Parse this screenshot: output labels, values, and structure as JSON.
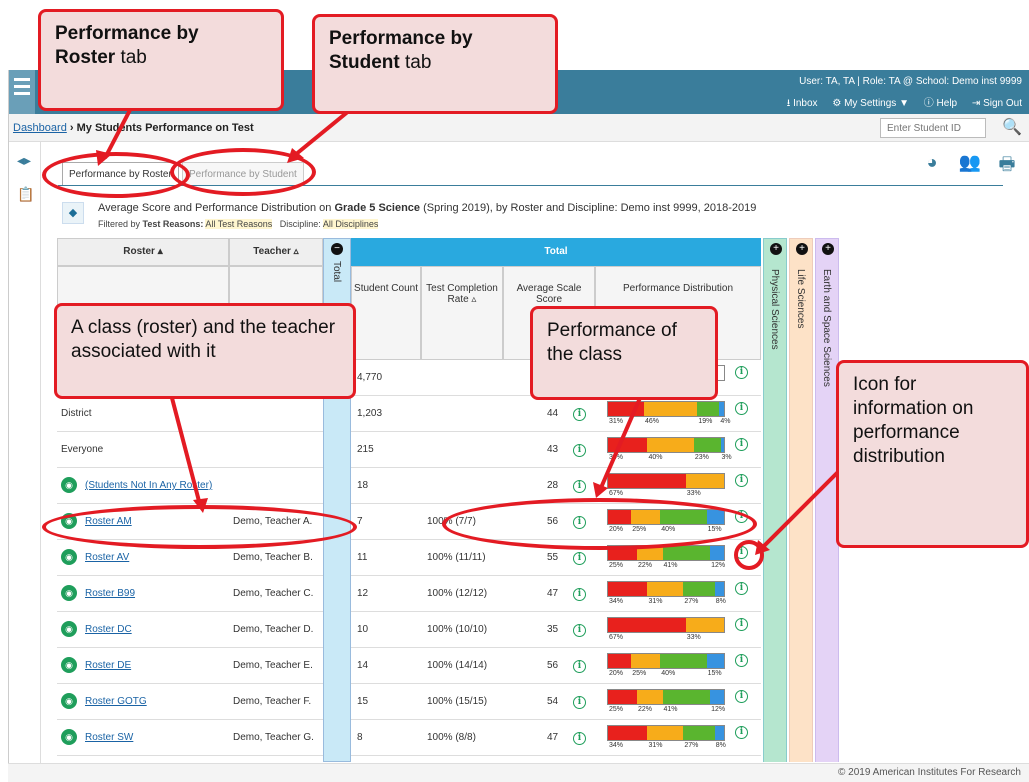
{
  "header": {
    "user_info": "User: TA, TA  |  Role: TA @ School: Demo inst 9999",
    "menu": [
      "Inbox",
      "My Settings ▼",
      "Help",
      "Sign Out"
    ]
  },
  "breadcrumb": {
    "home": "Dashboard",
    "separator": "›",
    "current": "My Students Performance on Test"
  },
  "search": {
    "placeholder": "Enter Student ID"
  },
  "tabs": [
    "Performance by Roster",
    "Performance by Student"
  ],
  "report": {
    "title_prefix": "Average Score and Performance Distribution on ",
    "title_bold": "Grade 5 Science",
    "title_suffix": " (Spring 2019), by Roster and Discipline: Demo inst 9999, 2018-2019",
    "filter_label1": "Filtered by ",
    "filter_key1": "Test Reasons:",
    "filter_val1": "All Test Reasons",
    "filter_key2": "Discipline:",
    "filter_val2": "All Disciplines"
  },
  "table": {
    "headers": {
      "roster": "Roster",
      "teacher": "Teacher",
      "total_band": "Total",
      "total_group": "Total",
      "student_count": "Student Count",
      "completion": "Test Completion Rate",
      "avg_score": "Average Scale Score",
      "distribution": "Performance Distribution"
    },
    "bands": [
      "Physical Sciences",
      "Life Sciences",
      "Earth and Space Sciences"
    ],
    "rows": [
      {
        "roster": "",
        "teacher": "",
        "count": "4,770",
        "rate": "",
        "avg": "",
        "dist": [
          0,
          0,
          0,
          0
        ],
        "labels": [
          "",
          "",
          "",
          ""
        ]
      },
      {
        "roster": "District",
        "teacher": "",
        "count": "1,203",
        "rate": "",
        "avg": "44",
        "dist": [
          31,
          46,
          19,
          4
        ],
        "labels": [
          "31%",
          "46%",
          "19%",
          "4%"
        ]
      },
      {
        "roster": "Everyone",
        "teacher": "",
        "count": "215",
        "rate": "",
        "avg": "43",
        "dist": [
          34,
          40,
          23,
          3
        ],
        "labels": [
          "34%",
          "40%",
          "23%",
          "3%"
        ]
      },
      {
        "roster": "(Students Not In Any Roster)",
        "teacher": "",
        "count": "18",
        "rate": "",
        "avg": "28",
        "dist": [
          67,
          33,
          0,
          0
        ],
        "labels": [
          "67%",
          "33%",
          "",
          ""
        ]
      },
      {
        "roster": "Roster AM",
        "teacher": "Demo, Teacher A.",
        "count": "7",
        "rate": "100% (7/7)",
        "avg": "56",
        "dist": [
          20,
          25,
          40,
          15
        ],
        "labels": [
          "20%",
          "25%",
          "40%",
          "15%"
        ]
      },
      {
        "roster": "Roster AV",
        "teacher": "Demo, Teacher B.",
        "count": "11",
        "rate": "100% (11/11)",
        "avg": "55",
        "dist": [
          25,
          22,
          41,
          12
        ],
        "labels": [
          "25%",
          "22%",
          "41%",
          "12%"
        ]
      },
      {
        "roster": "Roster B99",
        "teacher": "Demo, Teacher C.",
        "count": "12",
        "rate": "100% (12/12)",
        "avg": "47",
        "dist": [
          34,
          31,
          27,
          8
        ],
        "labels": [
          "34%",
          "31%",
          "27%",
          "8%"
        ]
      },
      {
        "roster": "Roster DC",
        "teacher": "Demo, Teacher D.",
        "count": "10",
        "rate": "100% (10/10)",
        "avg": "35",
        "dist": [
          67,
          33,
          0,
          0
        ],
        "labels": [
          "67%",
          "33%",
          "",
          ""
        ]
      },
      {
        "roster": "Roster DE",
        "teacher": "Demo, Teacher E.",
        "count": "14",
        "rate": "100% (14/14)",
        "avg": "56",
        "dist": [
          20,
          25,
          40,
          15
        ],
        "labels": [
          "20%",
          "25%",
          "40%",
          "15%"
        ]
      },
      {
        "roster": "Roster GOTG",
        "teacher": "Demo, Teacher F.",
        "count": "15",
        "rate": "100% (15/15)",
        "avg": "54",
        "dist": [
          25,
          22,
          41,
          12
        ],
        "labels": [
          "25%",
          "22%",
          "41%",
          "12%"
        ]
      },
      {
        "roster": "Roster SW",
        "teacher": "Demo, Teacher G.",
        "count": "8",
        "rate": "100% (8/8)",
        "avg": "47",
        "dist": [
          34,
          31,
          27,
          8
        ],
        "labels": [
          "34%",
          "31%",
          "27%",
          "8%"
        ]
      }
    ],
    "dist_colors": [
      "#e8211d",
      "#f7ac1a",
      "#5ab52f",
      "#3793e0"
    ]
  },
  "footer": "© 2019 American Institutes For Research",
  "callouts": {
    "roster_tab_1": "Performance by",
    "roster_tab_bold": "Roster",
    "roster_tab_2": " tab",
    "student_tab_1": "Performance by",
    "student_tab_bold": "Student",
    "student_tab_2": " tab",
    "class": "A class (roster) and the teacher associated with it",
    "performance": "Performance of the class",
    "icon": "Icon for information on performance distribution"
  }
}
